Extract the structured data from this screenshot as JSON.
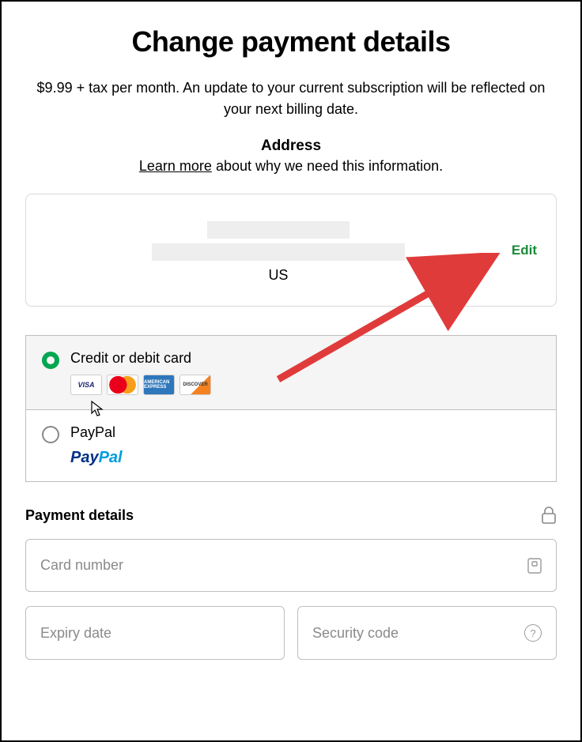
{
  "title": "Change payment details",
  "subtext": "$9.99 + tax per month. An update to your current subscription will be reflected on your next billing date.",
  "address": {
    "heading": "Address",
    "learn_more": "Learn more",
    "learn_more_tail": " about why we need this information.",
    "country": "US",
    "edit": "Edit"
  },
  "methods": {
    "card_label": "Credit or debit card",
    "paypal_label": "PayPal",
    "logos": {
      "visa": "VISA",
      "amex": "AMERICAN EXPRESS",
      "discover": "DISCOVER"
    }
  },
  "details": {
    "heading": "Payment details",
    "card_number_ph": "Card number",
    "expiry_ph": "Expiry date",
    "security_ph": "Security code"
  }
}
